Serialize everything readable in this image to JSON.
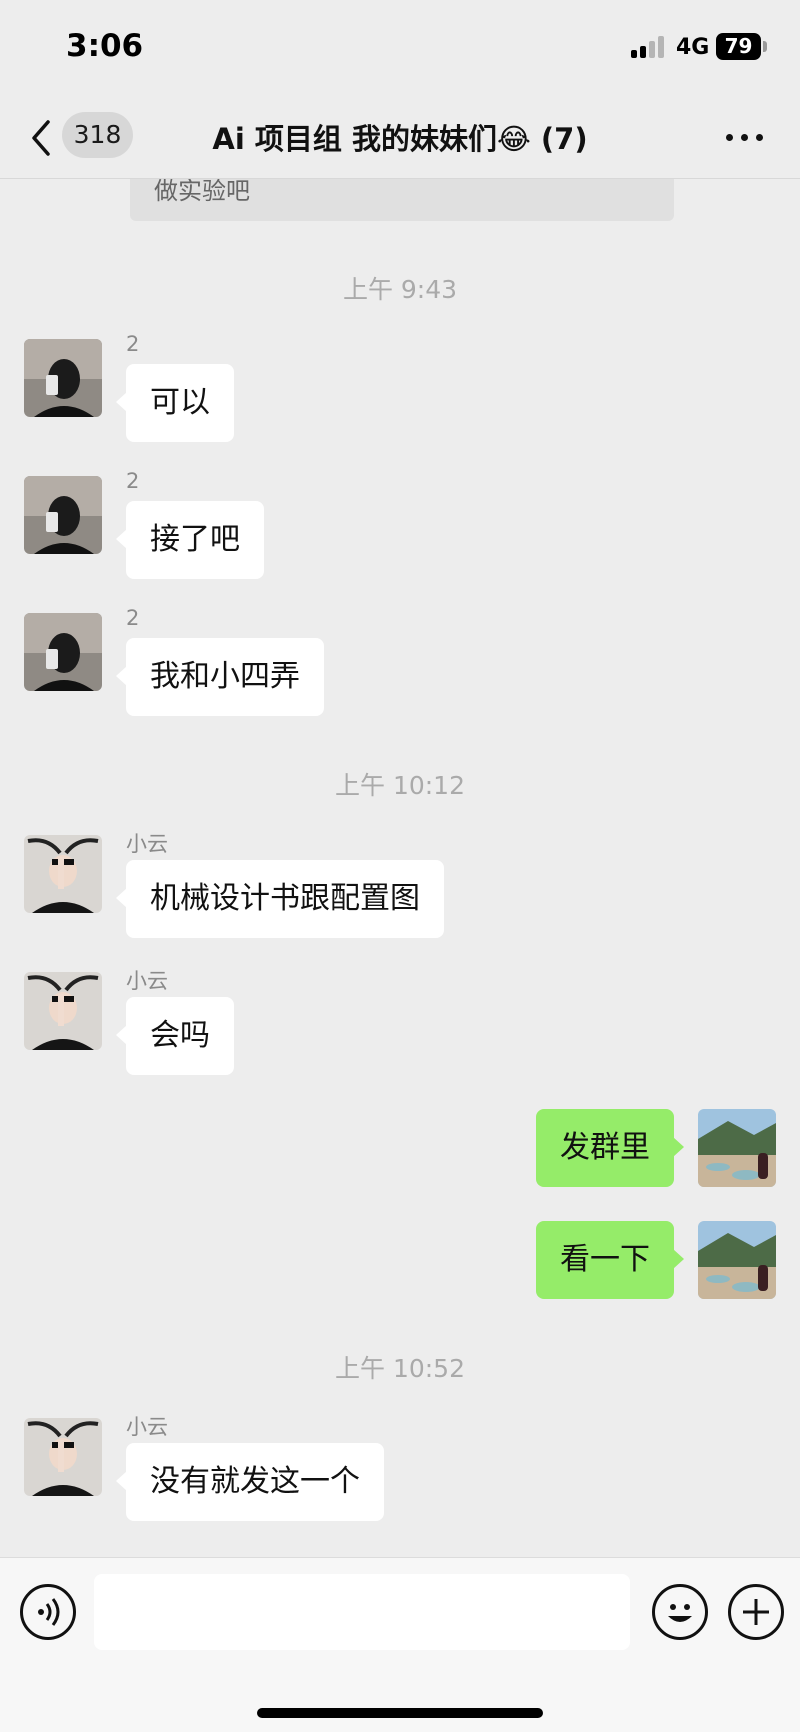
{
  "status": {
    "time": "3:06",
    "network": "4G",
    "battery": "79"
  },
  "nav": {
    "unread_count": "318",
    "title": "Ai 项目组 我的妹妹们😂 (7)"
  },
  "top_quote": "做实验吧",
  "timestamps": [
    "上午 9:43",
    "上午 10:12",
    "上午 10:52"
  ],
  "messages": [
    {
      "sender": "2",
      "text": "可以"
    },
    {
      "sender": "2",
      "text": "接了吧"
    },
    {
      "sender": "2",
      "text": "我和小四弄"
    },
    {
      "sender": "小云",
      "text": "机械设计书跟配置图"
    },
    {
      "sender": "小云",
      "text": "会吗"
    },
    {
      "sender": "me",
      "text": "发群里"
    },
    {
      "sender": "me",
      "text": "看一下"
    },
    {
      "sender": "小云",
      "text": "没有就发这一个"
    }
  ],
  "icons": {
    "back": "chevron-left-icon",
    "more": "more-dots-icon",
    "voice": "voice-icon",
    "emoji": "emoji-icon",
    "plus": "plus-icon"
  },
  "colors": {
    "background": "#ededed",
    "my_bubble": "#95ec69",
    "other_bubble": "#ffffff"
  }
}
